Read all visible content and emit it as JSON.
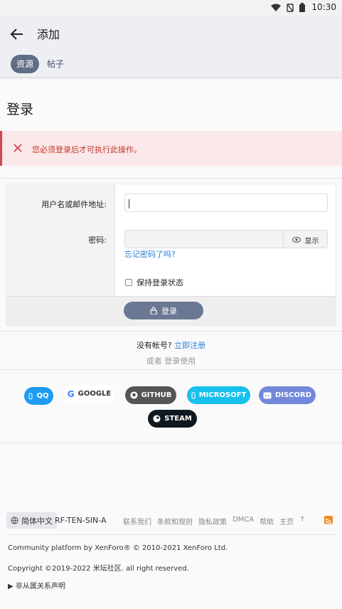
{
  "status_bar": {
    "time": "10:30"
  },
  "app_bar": {
    "title": "添加",
    "tabs": [
      {
        "label": "资源",
        "active": true
      },
      {
        "label": "帖子",
        "active": false
      }
    ]
  },
  "page": {
    "title": "登录",
    "error_message": "您必须登录后才可执行此操作。"
  },
  "form": {
    "username_label": "用户名或邮件地址:",
    "username_value": "",
    "password_label": "密码:",
    "show_password_label": "显示",
    "forgot_password": "忘记密码了吗?",
    "remember_me": "保持登录状态",
    "login_button": "登录"
  },
  "register": {
    "prompt": "没有帐号?",
    "link": "立即注册",
    "or_text": "或者 登录使用"
  },
  "social_logins": {
    "qq": "QQ",
    "google": "GOOGLE",
    "github": "GITHUB",
    "microsoft": "MICROSOFT",
    "discord": "DISCORD",
    "steam": "STEAM"
  },
  "footer": {
    "language": "简体中文",
    "style": "RF-TEN-SIN-A",
    "links": [
      "联系我们",
      "条款和规则",
      "隐私政策",
      "DMCA",
      "帮助",
      "主页"
    ],
    "copyright_line1": "Community platform by XenForo® © 2010-2021 XenForo Ltd.",
    "copyright_line2": "Copyright ©2019-2022 米坛社区. all right reserved.",
    "disclaimer": "非从属关系声明"
  },
  "colors": {
    "accent": "#5f6d86",
    "link": "#2b7fd4",
    "error": "#d2474f"
  }
}
